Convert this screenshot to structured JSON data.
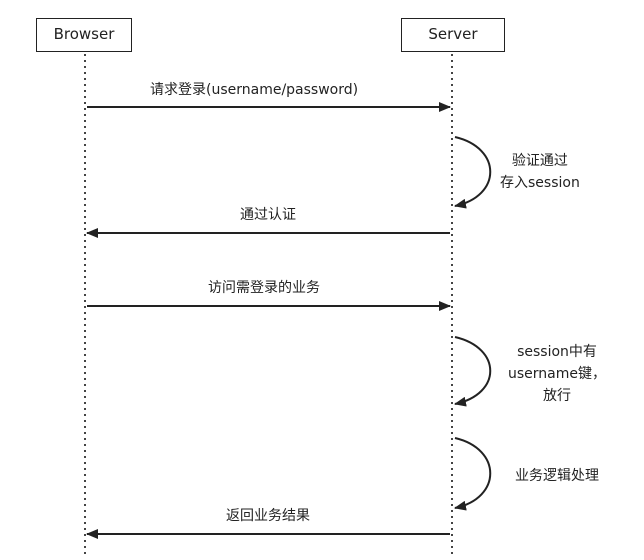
{
  "participants": {
    "browser": "Browser",
    "server": "Server"
  },
  "messages": {
    "login_request": "请求登录(username/password)",
    "auth_passed": "通过认证",
    "access_business": "访问需登录的业务",
    "return_result": "返回业务结果"
  },
  "self_notes": {
    "verify": [
      "验证通过",
      "存入session"
    ],
    "check_session": [
      "session中有",
      "username键，",
      "放行"
    ],
    "business_logic": [
      "业务逻辑处理"
    ]
  },
  "colors": {
    "line": "#222222",
    "lifeline": "#444444"
  }
}
